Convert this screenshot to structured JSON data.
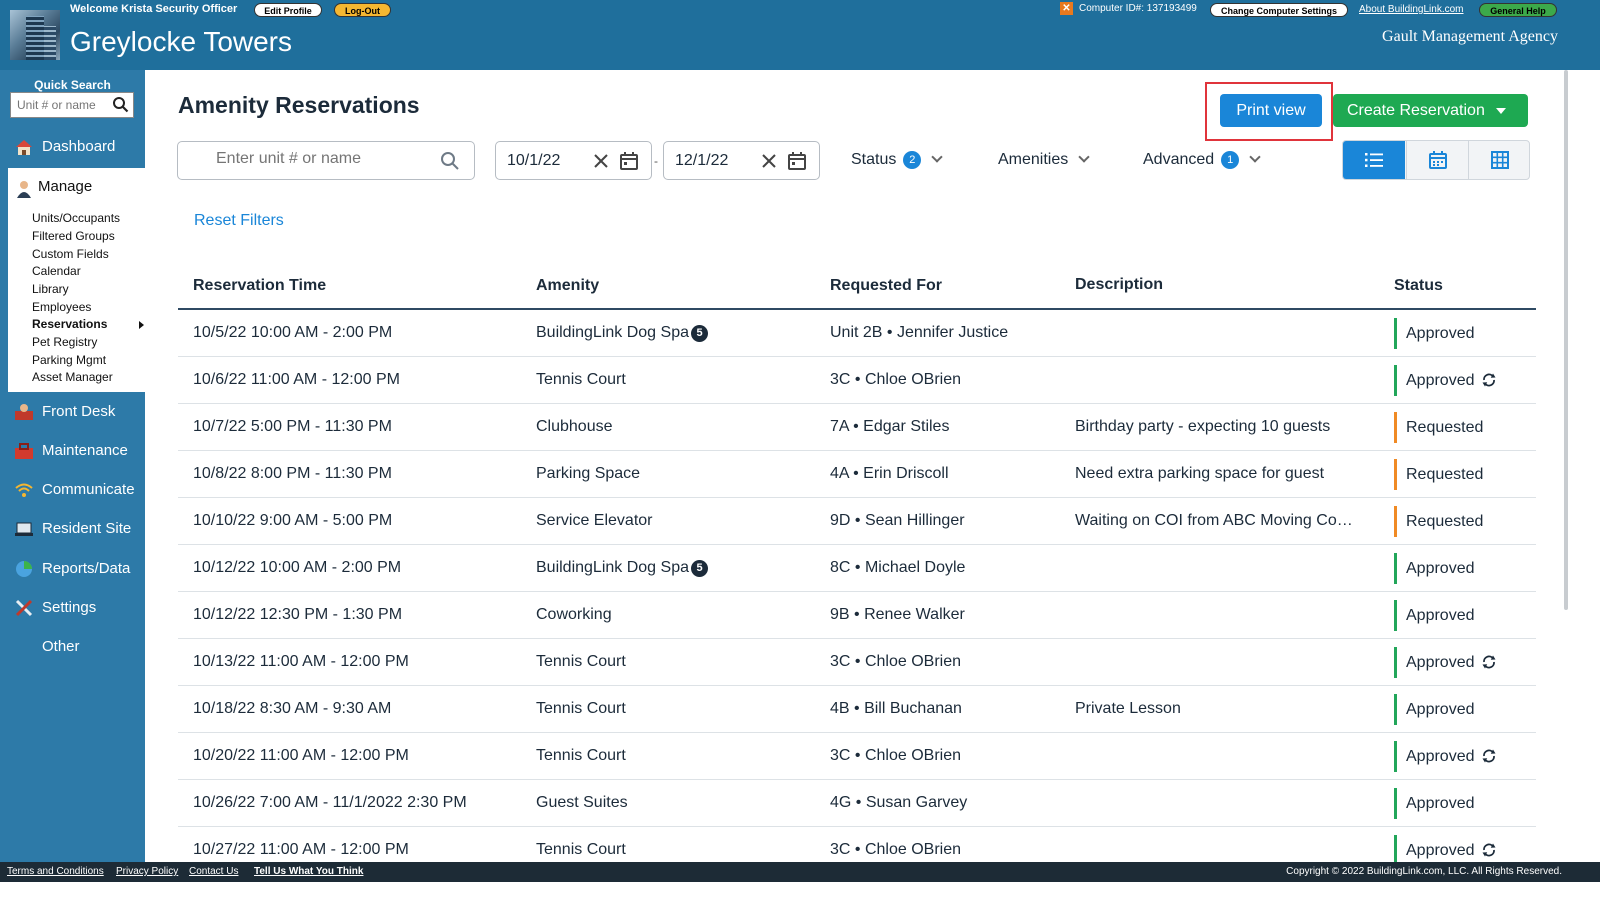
{
  "header": {
    "welcome": "Welcome  Krista Security Officer",
    "edit_profile": "Edit Profile",
    "logout": "Log-Out",
    "building_name": "Greylocke Towers",
    "computer_id_label": "Computer ID#:  137193499",
    "change_settings": "Change Computer Settings",
    "about_link": "About BuildingLink.com",
    "general_help": "General Help",
    "agency": "Gault Management Agency"
  },
  "sidebar": {
    "quick_search_label": "Quick Search",
    "quick_search_placeholder": "Unit # or name",
    "dashboard": "Dashboard",
    "manage": "Manage",
    "manage_items": [
      "Units/Occupants",
      "Filtered Groups",
      "Custom Fields",
      "Calendar",
      "Library",
      "Employees",
      "Reservations",
      "Pet Registry",
      "Parking Mgmt",
      "Asset Manager"
    ],
    "front_desk": "Front Desk",
    "maintenance": "Maintenance",
    "communicate": "Communicate",
    "resident_site": "Resident Site",
    "reports": "Reports/Data",
    "settings": "Settings",
    "other": "Other"
  },
  "main": {
    "title": "Amenity Reservations",
    "print_view": "Print view",
    "create_reservation": "Create Reservation",
    "search_placeholder": "Enter unit # or name",
    "date_start": "10/1/22",
    "date_separator": "-",
    "date_end": "12/1/22",
    "status_filter": "Status",
    "status_count": "2",
    "amenities_filter": "Amenities",
    "advanced_filter": "Advanced",
    "advanced_count": "1",
    "reset_filters": "Reset Filters"
  },
  "table": {
    "columns": [
      "Reservation Time",
      "Amenity",
      "Requested For",
      "Description",
      "Status"
    ],
    "rows": [
      {
        "time": "10/5/22 10:00 AM - 2:00 PM",
        "amenity": "BuildingLink Dog Spa",
        "badge": "5",
        "requested_for": "Unit 2B • Jennifer Justice",
        "description": "",
        "status": "Approved",
        "recurring": false
      },
      {
        "time": "10/6/22 11:00 AM - 12:00 PM",
        "amenity": "Tennis Court",
        "badge": "",
        "requested_for": "3C • Chloe OBrien",
        "description": "",
        "status": "Approved",
        "recurring": true
      },
      {
        "time": "10/7/22 5:00 PM - 11:30 PM",
        "amenity": "Clubhouse",
        "badge": "",
        "requested_for": "7A • Edgar Stiles",
        "description": "Birthday party - expecting 10 guests",
        "status": "Requested",
        "recurring": false
      },
      {
        "time": "10/8/22 8:00 PM - 11:30 PM",
        "amenity": "Parking Space",
        "badge": "",
        "requested_for": "4A • Erin Driscoll",
        "description": "Need extra parking space for guest",
        "status": "Requested",
        "recurring": false
      },
      {
        "time": "10/10/22 9:00 AM - 5:00 PM",
        "amenity": "Service Elevator",
        "badge": "",
        "requested_for": "9D • Sean Hillinger",
        "description": "Waiting on COI from ABC Moving Com...",
        "status": "Requested",
        "recurring": false
      },
      {
        "time": "10/12/22 10:00 AM - 2:00 PM",
        "amenity": "BuildingLink Dog Spa",
        "badge": "5",
        "requested_for": "8C • Michael Doyle",
        "description": "",
        "status": "Approved",
        "recurring": false
      },
      {
        "time": "10/12/22 12:30 PM - 1:30 PM",
        "amenity": "Coworking",
        "badge": "",
        "requested_for": "9B • Renee Walker",
        "description": "",
        "status": "Approved",
        "recurring": false
      },
      {
        "time": "10/13/22 11:00 AM - 12:00 PM",
        "amenity": "Tennis Court",
        "badge": "",
        "requested_for": "3C • Chloe OBrien",
        "description": "",
        "status": "Approved",
        "recurring": true
      },
      {
        "time": "10/18/22 8:30 AM - 9:30 AM",
        "amenity": "Tennis Court",
        "badge": "",
        "requested_for": "4B • Bill Buchanan",
        "description": "Private Lesson",
        "status": "Approved",
        "recurring": false
      },
      {
        "time": "10/20/22 11:00 AM - 12:00 PM",
        "amenity": "Tennis Court",
        "badge": "",
        "requested_for": "3C • Chloe OBrien",
        "description": "",
        "status": "Approved",
        "recurring": true
      },
      {
        "time": "10/26/22 7:00 AM - 11/1/2022 2:30 PM",
        "amenity": "Guest Suites",
        "badge": "",
        "requested_for": "4G • Susan Garvey",
        "description": "",
        "status": "Approved",
        "recurring": false
      },
      {
        "time": "10/27/22 11:00 AM - 12:00 PM",
        "amenity": "Tennis Court",
        "badge": "",
        "requested_for": "3C • Chloe OBrien",
        "description": "",
        "status": "Approved",
        "recurring": true
      }
    ]
  },
  "footer": {
    "terms": "Terms and Conditions",
    "privacy": "Privacy Policy",
    "contact": "Contact Us",
    "feedback": "Tell Us What You Think",
    "copyright": "Copyright © 2022 BuildingLink.com, LLC.   All Rights Reserved."
  },
  "colors": {
    "header_blue": "#1f6f9c",
    "sidebar_blue": "#2d7aa8",
    "primary_blue": "#1a86d8",
    "create_green": "#1ea952",
    "approved_green": "#22a65a",
    "requested_orange": "#f08a24",
    "highlight_red": "#e0343b"
  }
}
